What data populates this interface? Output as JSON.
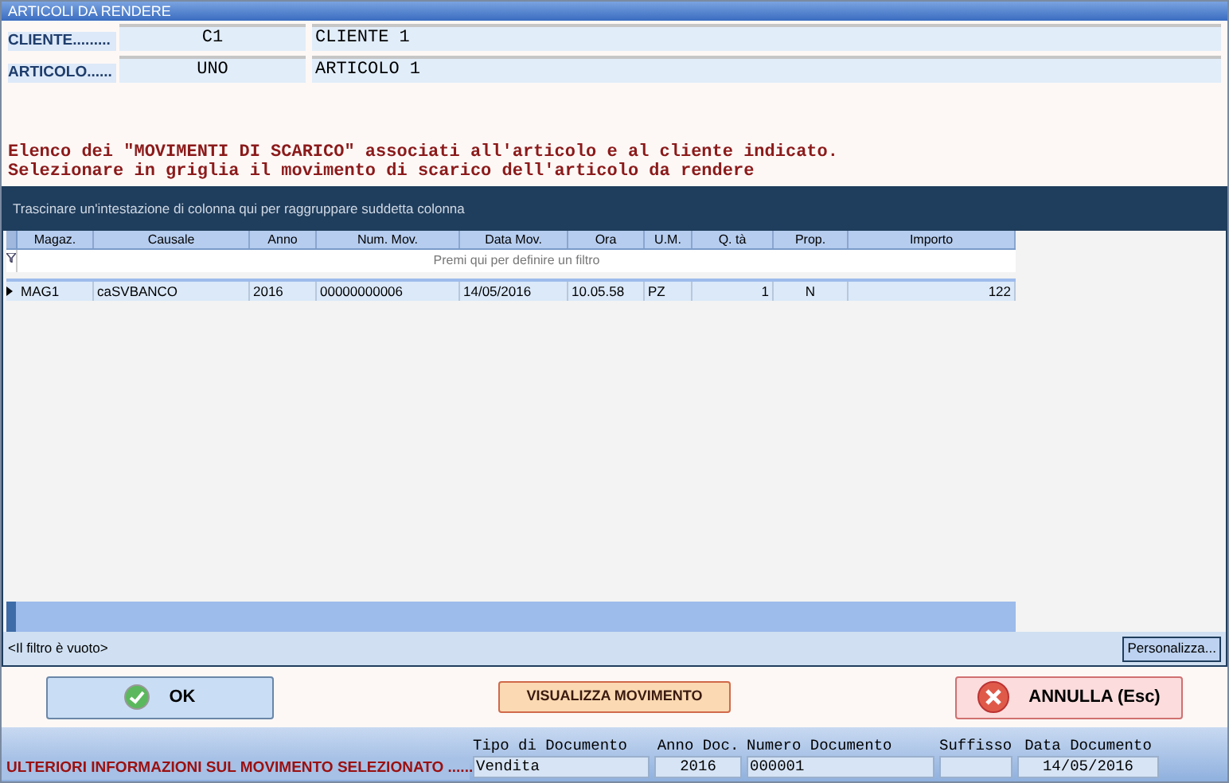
{
  "window": {
    "title": "ARTICOLI DA RENDERE"
  },
  "header": [
    {
      "label": "CLIENTE.........",
      "code": "C1",
      "description": "CLIENTE 1"
    },
    {
      "label": "ARTICOLO......",
      "code": "UNO",
      "description": "ARTICOLO 1"
    }
  ],
  "messages": [
    "Elenco dei \"MOVIMENTI DI SCARICO\" associati all'articolo e al cliente indicato.",
    "Selezionare in griglia il movimento di scarico dell'articolo da rendere"
  ],
  "group_panel": "Trascinare un'intestazione di colonna qui per raggruppare suddetta colonna",
  "table": {
    "columns": [
      {
        "label": "Magaz."
      },
      {
        "label": "Causale"
      },
      {
        "label": "Anno"
      },
      {
        "label": "Num. Mov."
      },
      {
        "label": "Data Mov."
      },
      {
        "label": "Ora"
      },
      {
        "label": "U.M."
      },
      {
        "label": "Q. tà"
      },
      {
        "label": "Prop."
      },
      {
        "label": "Importo"
      }
    ],
    "filter_row": "Premi qui per definire un filtro",
    "rows": [
      {
        "selected": true,
        "cells": [
          "MAG1",
          "caSVBANCO",
          "2016",
          "00000000006",
          "14/05/2016",
          "10.05.58",
          "PZ",
          "1",
          "N",
          "122"
        ]
      }
    ]
  },
  "filter_status": "<Il filtro è vuoto>",
  "customize_button": "Personalizza...",
  "buttons": [
    {
      "kind": "ok",
      "label": "OK"
    },
    {
      "kind": "view",
      "label": "VISUALIZZA MOVIMENTO"
    },
    {
      "kind": "cancel",
      "label": "ANNULLA (Esc)"
    }
  ],
  "info_bar": {
    "title": "ULTERIORI INFORMAZIONI SUL MOVIMENTO SELEZIONATO ......",
    "fields": [
      {
        "label": "Tipo di Documento",
        "value": "Vendita"
      },
      {
        "label": "Anno Doc.",
        "value": "2016"
      },
      {
        "label": "Numero Documento",
        "value": "000001"
      },
      {
        "label": "Suffisso"
      },
      {
        "label": "Data Documento",
        "value": "14/05/2016"
      }
    ]
  }
}
